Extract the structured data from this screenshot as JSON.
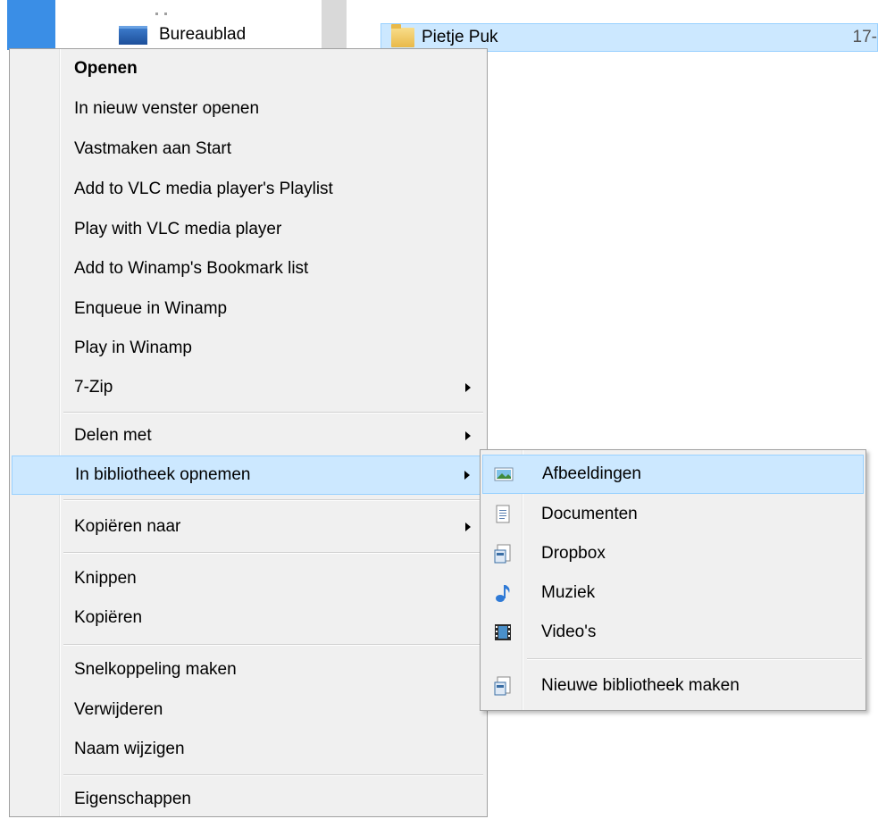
{
  "explorer": {
    "nav_item_label": "Bureaublad",
    "file_name": "Pietje Puk",
    "file_date": "17-"
  },
  "context_menu": {
    "items": [
      {
        "label": "Openen"
      },
      {
        "label": "In nieuw venster openen"
      },
      {
        "label": "Vastmaken aan Start"
      },
      {
        "label": "Add to VLC media player's Playlist"
      },
      {
        "label": "Play with VLC media player"
      },
      {
        "label": "Add to Winamp's Bookmark list"
      },
      {
        "label": "Enqueue in Winamp"
      },
      {
        "label": "Play in Winamp"
      },
      {
        "label": "7-Zip"
      },
      {
        "label": "Delen met"
      },
      {
        "label": "In bibliotheek opnemen"
      },
      {
        "label": "Kopiëren naar"
      },
      {
        "label": "Knippen"
      },
      {
        "label": "Kopiëren"
      },
      {
        "label": "Snelkoppeling maken"
      },
      {
        "label": "Verwijderen"
      },
      {
        "label": "Naam wijzigen"
      },
      {
        "label": "Eigenschappen"
      }
    ]
  },
  "submenu": {
    "items": [
      {
        "label": "Afbeeldingen",
        "icon": "pictures-library-icon"
      },
      {
        "label": "Documenten",
        "icon": "documents-library-icon"
      },
      {
        "label": "Dropbox",
        "icon": "library-icon"
      },
      {
        "label": "Muziek",
        "icon": "music-library-icon"
      },
      {
        "label": "Video's",
        "icon": "videos-library-icon"
      },
      {
        "label": "Nieuwe bibliotheek maken",
        "icon": "new-library-icon"
      }
    ]
  },
  "colors": {
    "highlight": "#cce8ff",
    "highlight_border": "#99d1ff",
    "menu_background": "#f0f0f0",
    "nav_selection": "#3a8ee6"
  }
}
